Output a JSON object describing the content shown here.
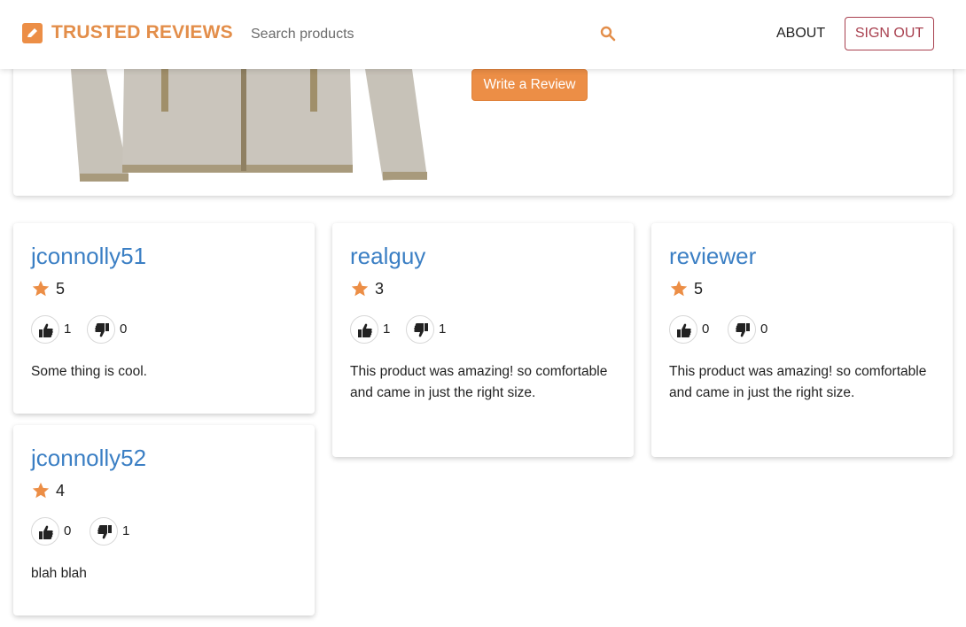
{
  "header": {
    "brand": "TRUSTED REVIEWS",
    "search_placeholder": "Search products",
    "about_label": "ABOUT",
    "signout_label": "SIGN OUT"
  },
  "product": {
    "write_review_label": "Write a Review"
  },
  "reviews": [
    {
      "username": "jconnolly51",
      "rating": "5",
      "upvotes": "1",
      "downvotes": "0",
      "text": "Some thing is cool."
    },
    {
      "username": "realguy",
      "rating": "3",
      "upvotes": "1",
      "downvotes": "1",
      "text": "This product was amazing! so comfortable and came in just the right size."
    },
    {
      "username": "reviewer",
      "rating": "5",
      "upvotes": "0",
      "downvotes": "0",
      "text": "This product was amazing! so comfortable and came in just the right size."
    },
    {
      "username": "jconnolly52",
      "rating": "4",
      "upvotes": "0",
      "downvotes": "1",
      "text": "blah blah"
    }
  ],
  "colors": {
    "accent": "#ec8e46",
    "link": "#3b7fc4",
    "signout": "#a8404f"
  },
  "icons": {
    "logo": "pencil-square-icon",
    "search": "search-icon",
    "rating": "star-icon",
    "upvote": "thumbs-up-icon",
    "downvote": "thumbs-down-icon"
  }
}
